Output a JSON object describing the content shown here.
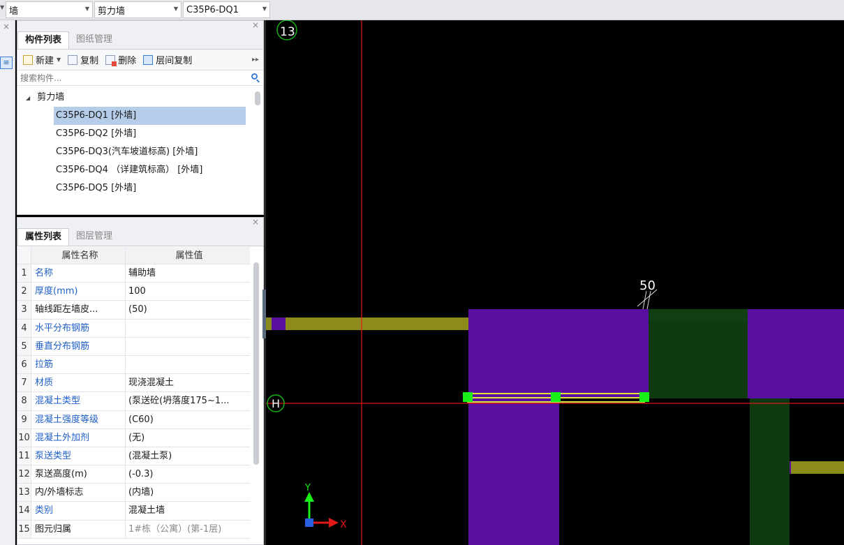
{
  "toolbar": {
    "combo1": "墙",
    "combo2": "剪力墙",
    "combo3": "C35P6-DQ1"
  },
  "component_panel": {
    "tabs": [
      "构件列表",
      "图纸管理"
    ],
    "actions": {
      "new": "新建",
      "copy": "复制",
      "delete": "删除",
      "layer_copy": "层间复制"
    },
    "search_placeholder": "搜索构件...",
    "tree_parent": "剪力墙",
    "items": [
      "C35P6-DQ1 [外墙]",
      "C35P6-DQ2 [外墙]",
      "C35P6-DQ3(汽车坡道标高) [外墙]",
      "C35P6-DQ4 （详建筑标高） [外墙]",
      "C35P6-DQ5 [外墙]"
    ],
    "selected_index": 0
  },
  "property_panel": {
    "tabs": [
      "属性列表",
      "图层管理"
    ],
    "headers": {
      "name": "属性名称",
      "value": "属性值"
    },
    "rows": [
      {
        "n": "1",
        "name": "名称",
        "value": "辅助墙",
        "blue": true
      },
      {
        "n": "2",
        "name": "厚度(mm)",
        "value": "100",
        "blue": true
      },
      {
        "n": "3",
        "name": "轴线距左墙皮...",
        "value": "(50)",
        "blue": false
      },
      {
        "n": "4",
        "name": "水平分布钢筋",
        "value": "",
        "blue": true
      },
      {
        "n": "5",
        "name": "垂直分布钢筋",
        "value": "",
        "blue": true
      },
      {
        "n": "6",
        "name": "拉筋",
        "value": "",
        "blue": true
      },
      {
        "n": "7",
        "name": "材质",
        "value": "现浇混凝土",
        "blue": true
      },
      {
        "n": "8",
        "name": "混凝土类型",
        "value": "(泵送砼(坍落度175~1...",
        "blue": true
      },
      {
        "n": "9",
        "name": "混凝土强度等级",
        "value": "(C60)",
        "blue": true
      },
      {
        "n": "10",
        "name": "混凝土外加剂",
        "value": "(无)",
        "blue": true
      },
      {
        "n": "11",
        "name": "泵送类型",
        "value": "(混凝土泵)",
        "blue": true
      },
      {
        "n": "12",
        "name": "泵送高度(m)",
        "value": "(-0.3)",
        "blue": false
      },
      {
        "n": "13",
        "name": "内/外墙标志",
        "value": "(内墙)",
        "blue": false
      },
      {
        "n": "14",
        "name": "类别",
        "value": "混凝土墙",
        "blue": true
      },
      {
        "n": "15",
        "name": "图元归属",
        "value": "1#栋（公寓）(第-1层)",
        "blue": false,
        "gray": true
      }
    ]
  },
  "canvas": {
    "axis_labels": {
      "grid_13": "13",
      "grid_h": "H"
    },
    "dimension": "50",
    "ucs": {
      "x": "X",
      "y": "Y"
    },
    "colors": {
      "background": "#000000",
      "wall_purple": "#5a0f9e",
      "wall_dark_green": "#0f3a10",
      "wall_olive": "#8c8c1c",
      "grid_red": "#e01818",
      "grip_green": "#18f018",
      "selection_yellow": "#e6e23c"
    }
  }
}
